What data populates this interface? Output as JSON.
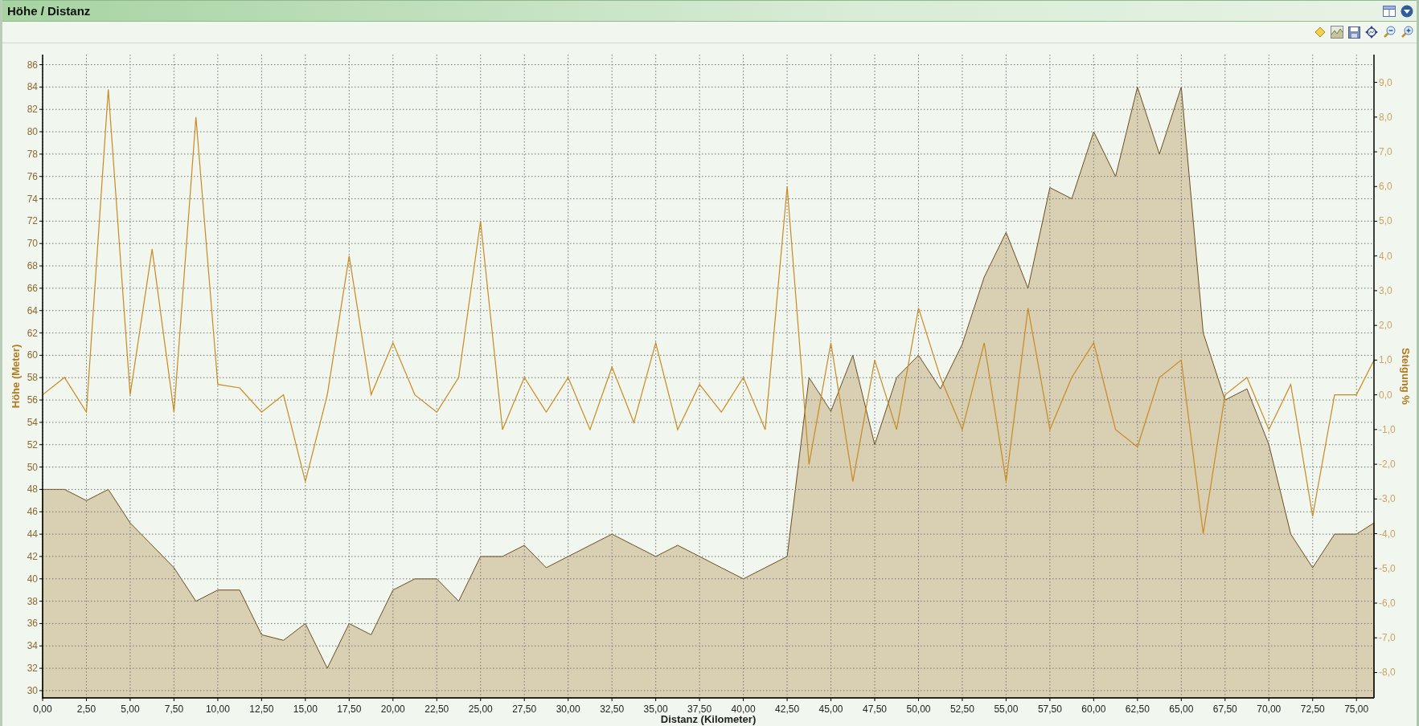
{
  "panel": {
    "title": "Höhe / Distanz"
  },
  "chart": {
    "chart_data": {
      "type": "area",
      "xlabel": "Distanz (Kilometer)",
      "ylabel": "Höhe (Meter)",
      "y2label": "Steigung %",
      "x": [
        0,
        1.25,
        2.5,
        3.75,
        5,
        6.25,
        7.5,
        8.75,
        10,
        11.25,
        12.5,
        13.75,
        15,
        16.25,
        17.5,
        18.75,
        20,
        21.25,
        22.5,
        23.75,
        25,
        26.25,
        27.5,
        28.75,
        30,
        31.25,
        32.5,
        33.75,
        35,
        36.25,
        37.5,
        38.75,
        40,
        41.25,
        42.5,
        43.75,
        45,
        46.25,
        47.5,
        48.75,
        50,
        51.25,
        52.5,
        53.75,
        55,
        56.25,
        57.5,
        58.75,
        60,
        61.25,
        62.5,
        63.75,
        65,
        66.25,
        67.5,
        68.75,
        70,
        71.25,
        72.5,
        73.75,
        75,
        76
      ],
      "series": [
        {
          "color": "#6b4e1f",
          "values": [
            48,
            48,
            47,
            48,
            45,
            43,
            41,
            38,
            39,
            39,
            35,
            34.5,
            36,
            32,
            36,
            35,
            39,
            40,
            40,
            38,
            42,
            42,
            43,
            41,
            42,
            43,
            44,
            43,
            42,
            43,
            42,
            41,
            40,
            41,
            42,
            58,
            55,
            60,
            52,
            58,
            60,
            57,
            61,
            67,
            71,
            66,
            75,
            74,
            80,
            76,
            84,
            78,
            84,
            62,
            56,
            57,
            52,
            44,
            41,
            44,
            44,
            45
          ]
        },
        {
          "color": "#c98a20",
          "axis": "y2",
          "type": "line",
          "values": [
            0,
            0.5,
            -0.5,
            8.8,
            0,
            4.2,
            -0.5,
            8,
            0.3,
            0.2,
            -0.5,
            0,
            -2.5,
            0,
            4,
            0,
            1.5,
            0,
            -0.5,
            0.5,
            5,
            -1,
            0.5,
            -0.5,
            0.5,
            -1,
            0.8,
            -0.8,
            1.5,
            -1,
            0.3,
            -0.5,
            0.5,
            -1,
            6,
            -2,
            1.5,
            -2.5,
            1,
            -1,
            2.5,
            0.5,
            -1,
            1.5,
            -2.5,
            2.5,
            -1,
            0.5,
            1.5,
            -1,
            -1.5,
            0.5,
            1,
            -4,
            0,
            0.5,
            -1,
            0.3,
            -3.5,
            0,
            0,
            1
          ]
        }
      ],
      "grid": true,
      "xlim": [
        0,
        76
      ],
      "ylim": [
        29.35,
        86.9
      ],
      "y2lim": [
        -8.73,
        9.8
      ],
      "xticks": [
        {
          "value": 0,
          "label": "0,00"
        },
        {
          "value": 2.5,
          "label": "2,50"
        },
        {
          "value": 5,
          "label": "5,00"
        },
        {
          "value": 7.5,
          "label": "7,50"
        },
        {
          "value": 10,
          "label": "10,00"
        },
        {
          "value": 12.5,
          "label": "12,50"
        },
        {
          "value": 15,
          "label": "15,00"
        },
        {
          "value": 17.5,
          "label": "17,50"
        },
        {
          "value": 20,
          "label": "20,00"
        },
        {
          "value": 22.5,
          "label": "22,50"
        },
        {
          "value": 25,
          "label": "25,00"
        },
        {
          "value": 27.5,
          "label": "27,50"
        },
        {
          "value": 30,
          "label": "30,00"
        },
        {
          "value": 32.5,
          "label": "32,50"
        },
        {
          "value": 35,
          "label": "35,00"
        },
        {
          "value": 37.5,
          "label": "37,50"
        },
        {
          "value": 40,
          "label": "40,00"
        },
        {
          "value": 42.5,
          "label": "42,50"
        },
        {
          "value": 45,
          "label": "45,00"
        },
        {
          "value": 47.5,
          "label": "47,50"
        },
        {
          "value": 50,
          "label": "50,00"
        },
        {
          "value": 52.5,
          "label": "52,50"
        },
        {
          "value": 55,
          "label": "55,00"
        },
        {
          "value": 57.5,
          "label": "57,50"
        },
        {
          "value": 60,
          "label": "60,00"
        },
        {
          "value": 62.5,
          "label": "62,50"
        },
        {
          "value": 65,
          "label": "65,00"
        },
        {
          "value": 67.5,
          "label": "67,50"
        },
        {
          "value": 70,
          "label": "70,00"
        },
        {
          "value": 72.5,
          "label": "72,50"
        },
        {
          "value": 75,
          "label": "75,00"
        }
      ],
      "yticks": [
        30,
        32,
        34,
        36,
        38,
        40,
        42,
        44,
        46,
        48,
        50,
        52,
        54,
        56,
        58,
        60,
        62,
        64,
        66,
        68,
        70,
        72,
        74,
        76,
        78,
        80,
        82,
        84,
        86
      ],
      "y2ticks": [
        {
          "value": 9,
          "label": "9,0"
        },
        {
          "value": 8,
          "label": "8,0"
        },
        {
          "value": 7,
          "label": "7,0"
        },
        {
          "value": 6,
          "label": "6,0"
        },
        {
          "value": 5,
          "label": "5,0"
        },
        {
          "value": 4,
          "label": "4,0"
        },
        {
          "value": 3,
          "label": "3,0"
        },
        {
          "value": 2,
          "label": "2,0"
        },
        {
          "value": 1,
          "label": "1,0"
        },
        {
          "value": 0,
          "label": "0,0"
        },
        {
          "value": -1,
          "label": "-1,0"
        },
        {
          "value": -2,
          "label": "-2,0"
        },
        {
          "value": -3,
          "label": "-3,0"
        },
        {
          "value": -4,
          "label": "-4,0"
        },
        {
          "value": -5,
          "label": "-5,0"
        },
        {
          "value": -6,
          "label": "-6,0"
        },
        {
          "value": -7,
          "label": "-7,0"
        },
        {
          "value": -8,
          "label": "-8,0"
        }
      ]
    }
  }
}
